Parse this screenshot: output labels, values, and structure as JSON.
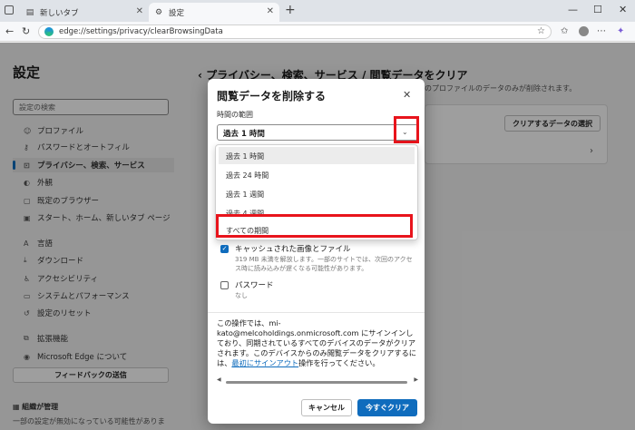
{
  "tabs": [
    {
      "label": "新しいタブ",
      "icon": "newtab-icon"
    },
    {
      "label": "設定",
      "icon": "gear-icon"
    }
  ],
  "address": {
    "url": "edge://settings/privacy/clearBrowsingData"
  },
  "sidebar": {
    "title": "設定",
    "search_placeholder": "設定の検索",
    "items": [
      {
        "label": "プロファイル",
        "icon": "profile-icon"
      },
      {
        "label": "パスワードとオートフィル",
        "icon": "key-icon"
      },
      {
        "label": "プライバシー、検索、サービス",
        "icon": "lock-icon",
        "active": true
      },
      {
        "label": "外観",
        "icon": "appearance-icon"
      },
      {
        "label": "既定のブラウザー",
        "icon": "browser-icon"
      },
      {
        "label": "スタート、ホーム、新しいタブ ページ",
        "icon": "home-icon"
      },
      {
        "label": "言語",
        "icon": "language-icon"
      },
      {
        "label": "ダウンロード",
        "icon": "download-icon"
      },
      {
        "label": "アクセシビリティ",
        "icon": "accessibility-icon"
      },
      {
        "label": "システムとパフォーマンス",
        "icon": "system-icon"
      },
      {
        "label": "設定のリセット",
        "icon": "reset-icon"
      },
      {
        "label": "拡張機能",
        "icon": "extension-icon"
      },
      {
        "label": "Microsoft Edge について",
        "icon": "edge-icon"
      }
    ],
    "feedback_button": "フィードバックの送信",
    "managed_title": "組織が管理",
    "managed_desc": "一部の設定が無効になっている可能性がありま"
  },
  "main": {
    "heading": "プライバシー、検索、サービス / 閲覧データをクリア",
    "subtext": "のプロファイルのデータのみが削除されます。",
    "choose_button": "クリアするデータの選択"
  },
  "dialog": {
    "title": "閲覧データを削除する",
    "range_label": "時間の範囲",
    "selected_range": "過去 1 時間",
    "range_options": [
      "過去 1 時間",
      "過去 24 時間",
      "過去 1 週間",
      "過去 4 週間",
      "すべての期間"
    ],
    "options": [
      {
        "label": "キャッシュされた画像とファイル",
        "checked": true,
        "desc": "319 MB 未満を解放します。一部のサイトでは、次回のアクセス時に読み込みが遅くなる可能性があります。"
      },
      {
        "label": "パスワード",
        "checked": false,
        "desc": "なし"
      }
    ],
    "info_before": "この操作では、mi-kato@melcoholdings.onmicrosoft.com にサインインしており、同期されているすべてのデバイスのデータがクリアされます。このデバイスからのみ閲覧データをクリアするには、",
    "info_link": "最初にサインアウト",
    "info_after": "操作を行ってください。",
    "cancel_button": "キャンセル",
    "clear_button": "今すぐクリア"
  }
}
